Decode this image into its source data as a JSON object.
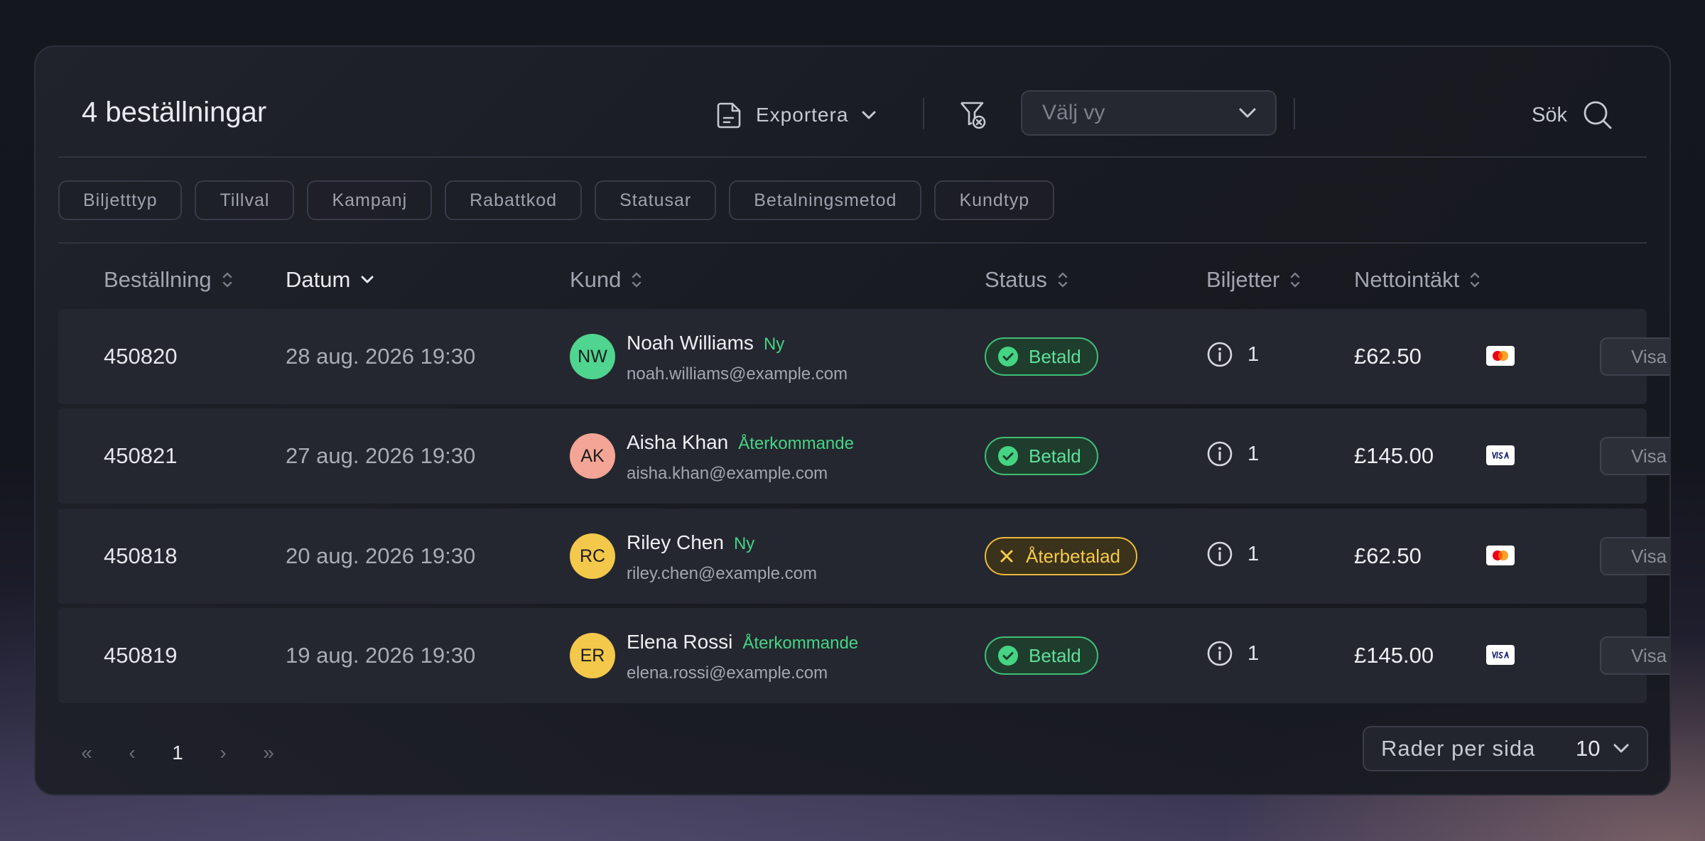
{
  "header": {
    "title": "4 beställningar",
    "export_label": "Exportera",
    "view_placeholder": "Välj vy",
    "search_label": "Sök"
  },
  "filters": [
    "Biljetttyp",
    "Tillval",
    "Kampanj",
    "Rabattkod",
    "Statusar",
    "Betalningsmetod",
    "Kundtyp"
  ],
  "columns": {
    "order": "Beställning",
    "date": "Datum",
    "customer": "Kund",
    "status": "Status",
    "tickets": "Biljetter",
    "net": "Nettointäkt"
  },
  "sorted_column": "Datum",
  "orders": [
    {
      "id": "450820",
      "date": "28 aug. 2026 19:30",
      "initials": "NW",
      "avatar_color": "#4fd58f",
      "name": "Noah Williams",
      "tag": "Ny",
      "email": "noah.williams@example.com",
      "status": "Betald",
      "status_kind": "paid",
      "tickets": "1",
      "amount": "£62.50",
      "card": "mastercard",
      "action": "Visa"
    },
    {
      "id": "450821",
      "date": "27 aug. 2026 19:30",
      "initials": "AK",
      "avatar_color": "#f4a595",
      "name": "Aisha Khan",
      "tag": "Återkommande",
      "email": "aisha.khan@example.com",
      "status": "Betald",
      "status_kind": "paid",
      "tickets": "1",
      "amount": "£145.00",
      "card": "visa",
      "action": "Visa"
    },
    {
      "id": "450818",
      "date": "20 aug. 2026 19:30",
      "initials": "RC",
      "avatar_color": "#f4c84a",
      "name": "Riley Chen",
      "tag": "Ny",
      "email": "riley.chen@example.com",
      "status": "Återbetalad",
      "status_kind": "refunded",
      "tickets": "1",
      "amount": "£62.50",
      "card": "mastercard",
      "action": "Visa"
    },
    {
      "id": "450819",
      "date": "19 aug. 2026 19:30",
      "initials": "ER",
      "avatar_color": "#f4c84a",
      "name": "Elena Rossi",
      "tag": "Återkommande",
      "email": "elena.rossi@example.com",
      "status": "Betald",
      "status_kind": "paid",
      "tickets": "1",
      "amount": "£145.00",
      "card": "visa",
      "action": "Visa"
    }
  ],
  "pagination": {
    "first": "«",
    "prev": "‹",
    "current": "1",
    "next": "›",
    "last": "»",
    "rows_label": "Rader per sida",
    "rows_value": "10"
  },
  "colors": {
    "accent_green": "#45d483",
    "refund_yellow": "#f5c94c"
  }
}
